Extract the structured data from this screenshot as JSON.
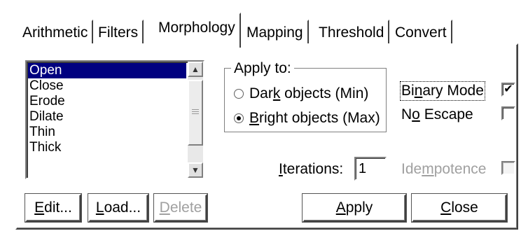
{
  "tabs": [
    {
      "id": "arithmetic",
      "label": "Arithmetic",
      "active": false
    },
    {
      "id": "filters",
      "label": "Filters",
      "active": false
    },
    {
      "id": "morphology",
      "label": "Morphology",
      "active": true
    },
    {
      "id": "mapping",
      "label": "Mapping",
      "active": false
    },
    {
      "id": "threshold",
      "label": "Threshold",
      "active": false
    },
    {
      "id": "convert",
      "label": "Convert",
      "active": false
    }
  ],
  "operations": {
    "items": [
      "Open",
      "Close",
      "Erode",
      "Dilate",
      "Thin",
      "Thick"
    ],
    "selected": "Open"
  },
  "apply_to": {
    "title": "Apply to:",
    "dark": {
      "pre": "Dar",
      "mn": "k",
      "post": " objects (Min)",
      "checked": false
    },
    "bright": {
      "pre": "",
      "mn": "B",
      "post": "right objects (Max)",
      "checked": true
    }
  },
  "options": {
    "binary": {
      "pre": "Bi",
      "mn": "n",
      "post": "ary Mode",
      "checked": true
    },
    "noescape": {
      "pre": "N",
      "mn": "o",
      "post": " Escape",
      "checked": false
    },
    "idempotence": {
      "pre": "Ide",
      "mn": "m",
      "post": "potence",
      "checked": false,
      "disabled": true
    }
  },
  "iterations": {
    "pre": "",
    "mn": "I",
    "post": "terations:",
    "value": "1"
  },
  "buttons": {
    "edit": {
      "pre": "",
      "mn": "E",
      "post": "dit..."
    },
    "load": {
      "pre": "",
      "mn": "L",
      "post": "oad..."
    },
    "delete": {
      "pre": "",
      "mn": "D",
      "post": "elete",
      "disabled": true
    },
    "apply": {
      "pre": "",
      "mn": "A",
      "post": "pply"
    },
    "close": {
      "pre": "",
      "mn": "C",
      "post": "lose"
    }
  },
  "icons": {
    "scroll_up": "scroll-up-icon",
    "scroll_down": "scroll-down-icon",
    "check": "checkmark-icon"
  }
}
